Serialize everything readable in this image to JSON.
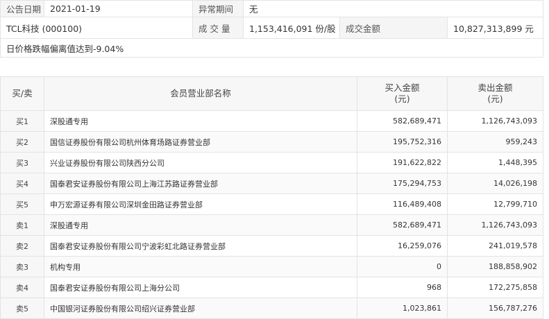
{
  "info": {
    "date_label": "公告日期",
    "date_value": "2021-01-19",
    "period_label": "异常期间",
    "period_value": "无",
    "stock_name": "TCL科技 (000100)",
    "volume_label": "成 交 量",
    "volume_value": "1,153,416,091 份/股",
    "amount_label": "成交金额",
    "amount_value": "10,827,313,899 元",
    "reason": "日价格跌幅偏离值达到-9.04%"
  },
  "table": {
    "headers": {
      "side": "买/卖",
      "name": "会员营业部名称",
      "buy_line1": "买入金额",
      "buy_line2": "(元)",
      "sell_line1": "卖出金额",
      "sell_line2": "(元)"
    },
    "rows": [
      {
        "side": "买1",
        "name": "深股通专用",
        "buy": "582,689,471",
        "sell": "1,126,743,093"
      },
      {
        "side": "买2",
        "name": "国信证券股份有限公司杭州体育场路证券营业部",
        "buy": "195,752,316",
        "sell": "959,243"
      },
      {
        "side": "买3",
        "name": "兴业证券股份有限公司陕西分公司",
        "buy": "191,622,822",
        "sell": "1,448,395"
      },
      {
        "side": "买4",
        "name": "国泰君安证券股份有限公司上海江苏路证券营业部",
        "buy": "175,294,753",
        "sell": "14,026,198"
      },
      {
        "side": "买5",
        "name": "申万宏源证券有限公司深圳金田路证券营业部",
        "buy": "116,489,408",
        "sell": "12,799,710"
      },
      {
        "side": "卖1",
        "name": "深股通专用",
        "buy": "582,689,471",
        "sell": "1,126,743,093"
      },
      {
        "side": "卖2",
        "name": "国泰君安证券股份有限公司宁波彩虹北路证券营业部",
        "buy": "16,259,076",
        "sell": "241,019,578"
      },
      {
        "side": "卖3",
        "name": "机构专用",
        "buy": "0",
        "sell": "188,858,902"
      },
      {
        "side": "卖4",
        "name": "国泰君安证券股份有限公司上海分公司",
        "buy": "968",
        "sell": "172,275,858"
      },
      {
        "side": "卖5",
        "name": "中国银河证券股份有限公司绍兴证券营业部",
        "buy": "1,023,861",
        "sell": "156,787,276"
      }
    ]
  }
}
